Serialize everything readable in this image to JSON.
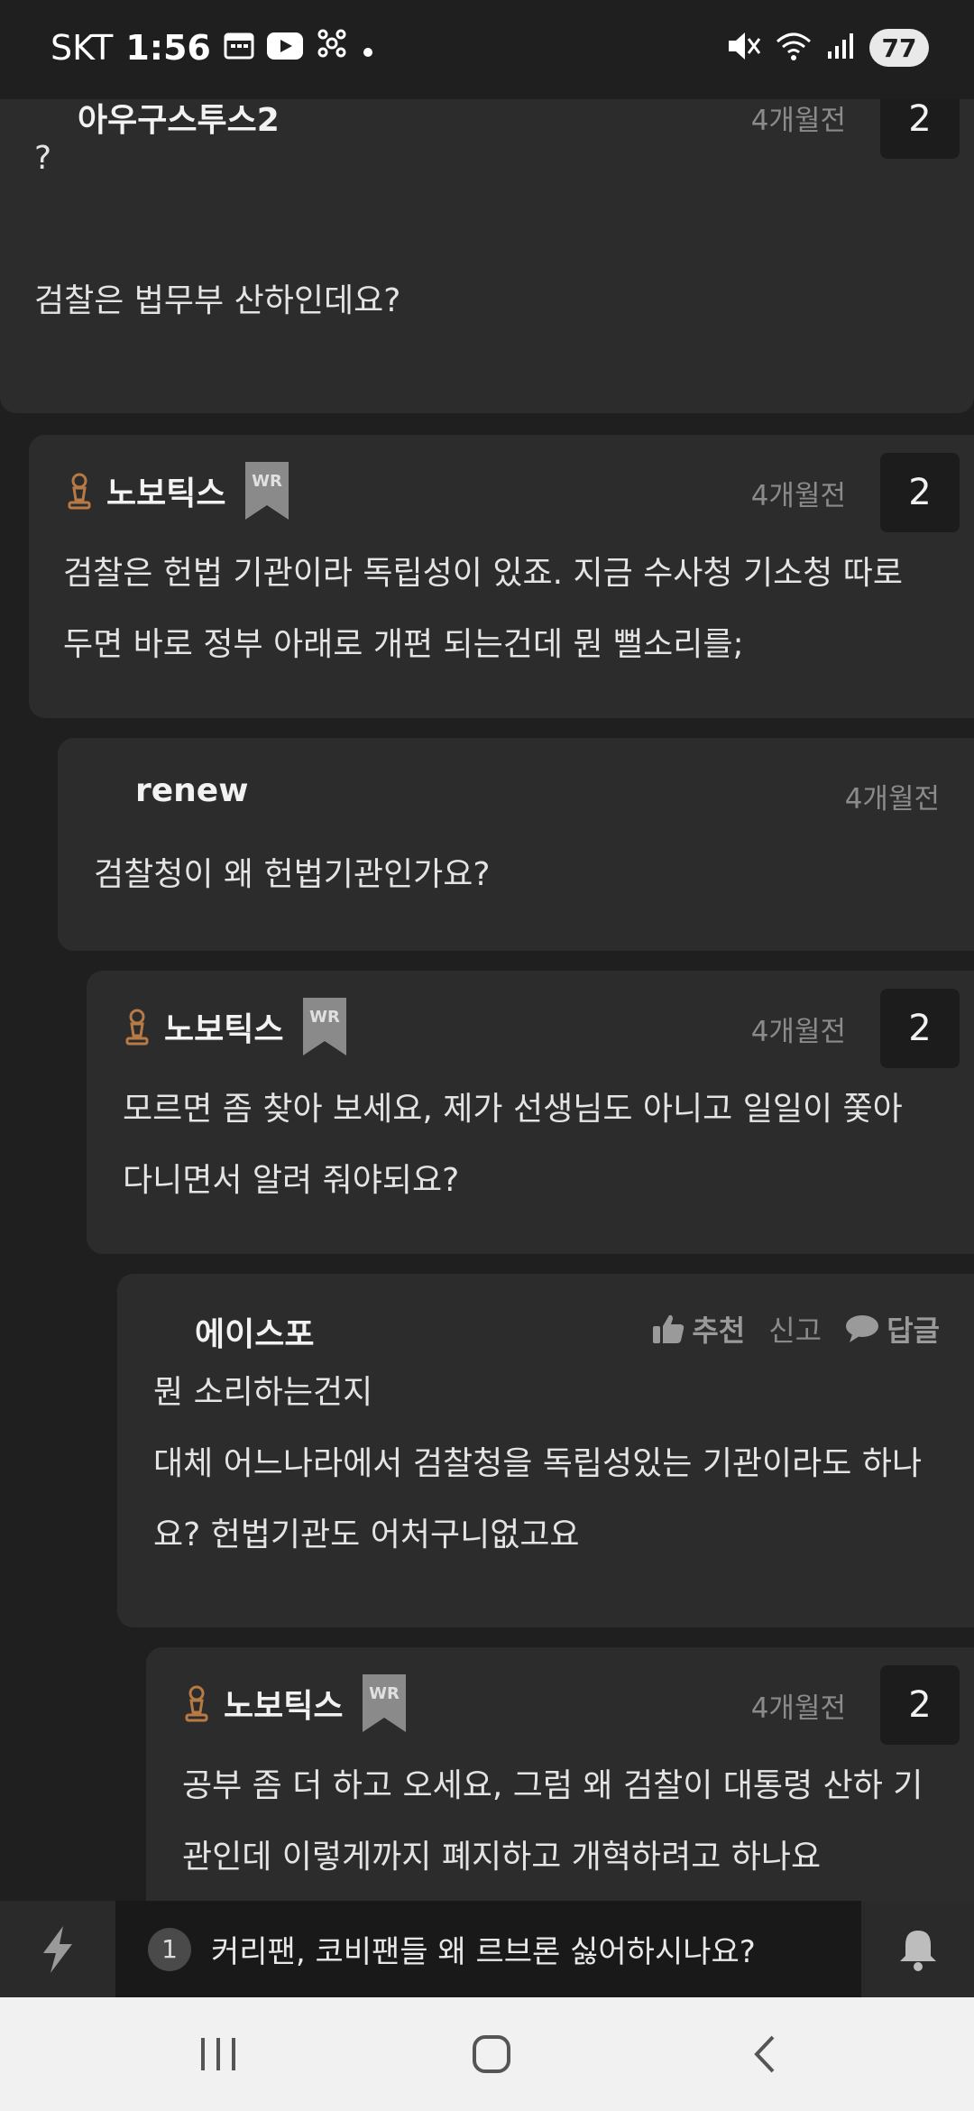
{
  "status_bar": {
    "carrier": "SKT",
    "time": "1:56",
    "battery": "77",
    "icons": [
      "calendar-icon",
      "youtube-icon",
      "app-icon",
      "dot-icon",
      "mute-icon",
      "wifi-icon",
      "signal-icon"
    ]
  },
  "comments": [
    {
      "author": "아우구스투스2",
      "time": "4개월전",
      "votes": "2",
      "lines": [
        "?",
        "",
        "검찰은 법무부 산하인데요?"
      ]
    },
    {
      "author": "노보틱스",
      "badge": "WR",
      "time": "4개월전",
      "votes": "2",
      "lines": [
        "검찰은 헌법 기관이라 독립성이 있죠. 지금 수사청 기소청 따로",
        "두면 바로 정부 아래로 개편 되는건데 뭔 뻘소리를;"
      ]
    },
    {
      "author": "renew",
      "time": "4개월전",
      "lines": [
        "검찰청이 왜 헌법기관인가요?"
      ]
    },
    {
      "author": "노보틱스",
      "badge": "WR",
      "time": "4개월전",
      "votes": "2",
      "lines": [
        "모르면 좀 찾아 보세요, 제가 선생님도 아니고 일일이 쫓아",
        "다니면서 알려 줘야되요?"
      ]
    },
    {
      "author": "에이스포",
      "actions": {
        "recommend": "추천",
        "report": "신고",
        "reply": "답글"
      },
      "lines": [
        "뭔 소리하는건지",
        "대체 어느나라에서 검찰청을 독립성있는 기관이라도 하나",
        "요? 헌법기관도 어처구니없고요"
      ]
    },
    {
      "author": "노보틱스",
      "badge": "WR",
      "time": "4개월전",
      "votes": "2",
      "lines": [
        "공부 좀 더 하고 오세요, 그럼 왜 검찰이 대통령 산하 기",
        "관인데 이렇게까지 폐지하고 개혁하려고 하나요"
      ]
    }
  ],
  "notice_bar": {
    "number": "1",
    "text": "커리팬, 코비팬들 왜 르브론 싫어하시나요?"
  },
  "colors": {
    "background": "#1f1f1f",
    "card": "#2c2c2c",
    "pin": "#b87a45",
    "badge": "#8a8a8a"
  }
}
